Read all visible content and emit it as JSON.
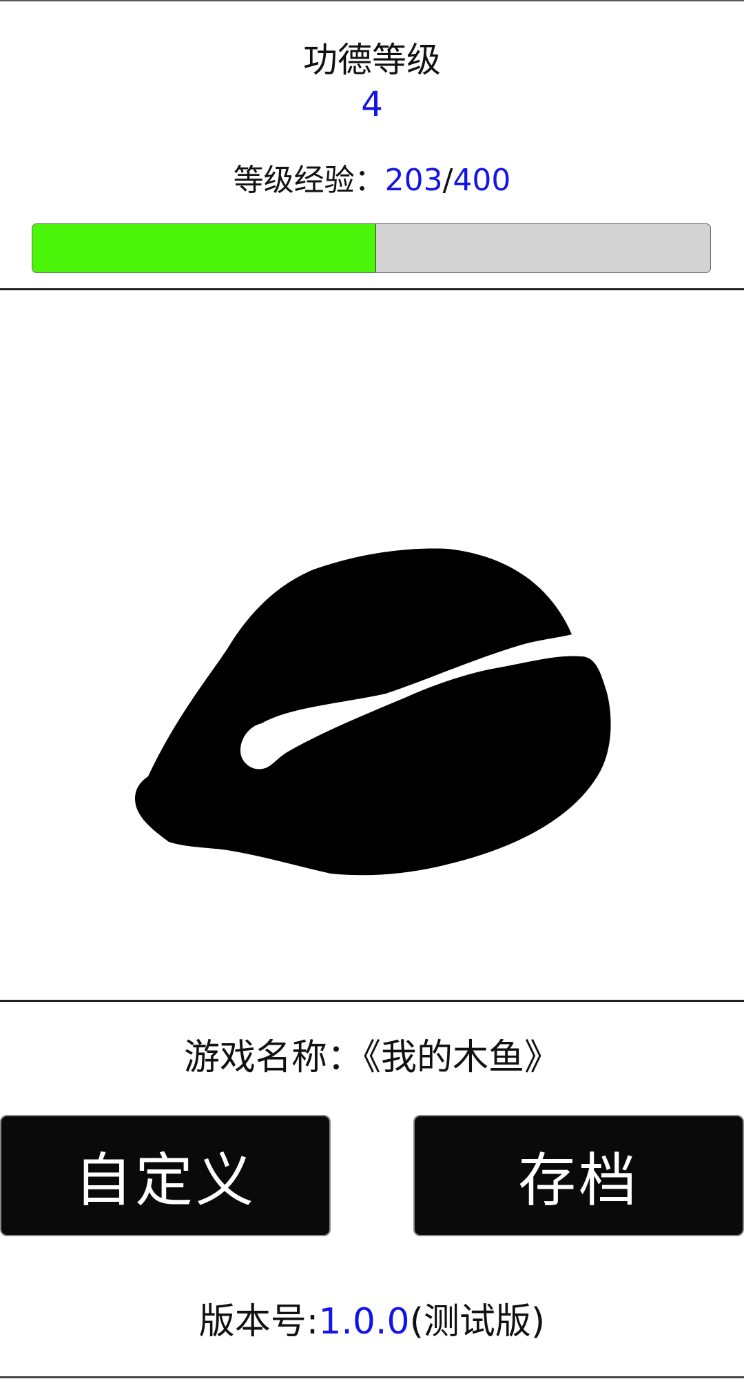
{
  "level": {
    "title": "功德等级",
    "value": "4"
  },
  "experience": {
    "label": "等级经验：",
    "current": "203",
    "separator": "/",
    "max": "400",
    "progress_fraction": 0.5075
  },
  "wooden_fish": {
    "icon": "wooden-fish-icon"
  },
  "game_name": {
    "label": "游戏名称：",
    "value": "《我的木鱼》"
  },
  "buttons": {
    "custom_label": "自定义",
    "save_label": "存档"
  },
  "version": {
    "label": "版本号:",
    "number": "1.0.0",
    "suffix": "(测试版)"
  },
  "colors": {
    "accent_blue": "#1414e6",
    "progress_green": "#4cf60a",
    "progress_track": "#d3d3d3",
    "button_bg": "#0a0a0a"
  }
}
